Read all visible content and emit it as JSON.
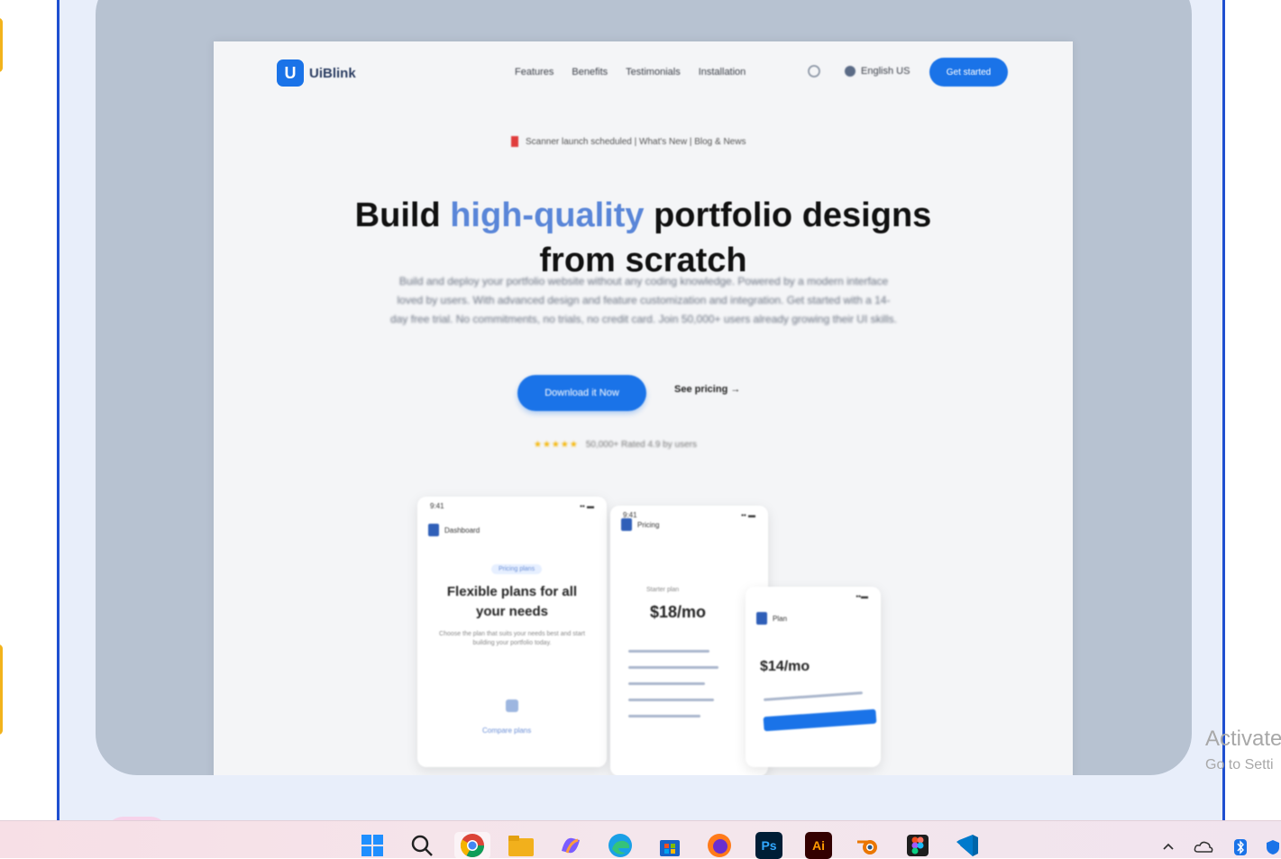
{
  "site": {
    "logo_text": "UiBlink",
    "nav_links": [
      "Features",
      "Benefits",
      "Testimonials",
      "Installation"
    ],
    "language": "English US",
    "nav_cta": "Get started",
    "announcement": "Scanner launch scheduled | What&apos;s New | Blog & News",
    "headline_part1": "Build ",
    "headline_highlight": "high-quality",
    "headline_part2": " portfolio designs",
    "headline_line2": "from scratch",
    "subtext": "Build and deploy your portfolio website without any coding knowledge. Powered by a modern interface loved by users. With advanced design and feature customization and integration. Get started with a 14-day free trial. No commitments, no trials, no credit card. Join 50,000+ users already growing their UI skills.",
    "primary_button": "Download it Now",
    "secondary_button": "See pricing",
    "secondary_arrow": "→",
    "stars": "★★★★★",
    "rating_text": "50,000+ Rated 4.9 by users"
  },
  "phones": {
    "p1": {
      "status_time": "9:41",
      "status_icons": "▪▪ ▬",
      "brand": "Dashboard",
      "pill": "Pricing plans",
      "title": "Flexible plans for all your needs",
      "desc": "Choose the plan that suits your needs best and start building your portfolio today.",
      "footer": "Compare plans"
    },
    "p2": {
      "status_time": "9:41",
      "status_icons": "▪▪ ▬",
      "brand": "Pricing",
      "small": "Starter plan",
      "price": "$18/mo"
    },
    "p3": {
      "status_icons": "▪▪▬",
      "brand": "Plan",
      "price": "$14/mo"
    }
  },
  "watermark": {
    "line1": "Activate",
    "line2": "Go to Setti"
  },
  "taskbar": {
    "apps": [
      "Start",
      "Search",
      "Chrome",
      "File Explorer",
      "Copilot",
      "Edge",
      "Microsoft Store",
      "Firefox",
      "Ps",
      "Ai",
      "Blender",
      "Figma",
      "VS Code"
    ],
    "tray": [
      "^",
      "OneDrive",
      "Bluetooth",
      "Security"
    ]
  },
  "colors": {
    "accent": "#1a73e8",
    "frame_border": "#1e4fd0",
    "headline_highlight": "#5a86d8"
  }
}
